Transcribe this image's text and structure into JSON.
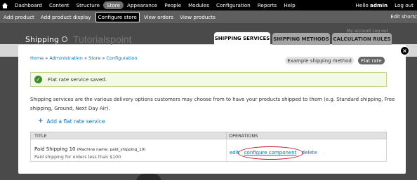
{
  "toolbar": {
    "items": [
      {
        "label": "Dashboard",
        "active": false
      },
      {
        "label": "Content",
        "active": false
      },
      {
        "label": "Structure",
        "active": false
      },
      {
        "label": "Store",
        "active": true
      },
      {
        "label": "Appearance",
        "active": false
      },
      {
        "label": "People",
        "active": false
      },
      {
        "label": "Modules",
        "active": false
      },
      {
        "label": "Configuration",
        "active": false
      },
      {
        "label": "Reports",
        "active": false
      },
      {
        "label": "Help",
        "active": false
      }
    ],
    "greeting": "Hello",
    "username": "admin",
    "logout": "Log out"
  },
  "shortcuts": {
    "items": [
      {
        "label": "Add product",
        "active": false
      },
      {
        "label": "Add product display",
        "active": false
      },
      {
        "label": "Configure store",
        "active": true
      },
      {
        "label": "View orders",
        "active": false
      },
      {
        "label": "View products",
        "active": false
      }
    ],
    "edit": "Edit shortc"
  },
  "page": {
    "title": "Shipping",
    "watermark": "Tutorialspoint",
    "my_account": "My account   Log out"
  },
  "tabs": [
    {
      "label": "SHIPPING SERVICES",
      "active": true
    },
    {
      "label": "SHIPPING METHODS",
      "active": false
    },
    {
      "label": "CALCULATION RULES",
      "active": false
    }
  ],
  "breadcrumb": [
    "Home",
    "Administration",
    "Store",
    "Configuration"
  ],
  "breadcrumb_sep": "»",
  "method_pills": [
    {
      "label": "Example shipping method",
      "active": false
    },
    {
      "label": "Flat rate",
      "active": true
    }
  ],
  "status": {
    "message": "Flat rate service saved."
  },
  "description": "Shipping services are the various delivery options customers may choose from to have your products shipped to them (e.g. Standard shipping, Free shipping, Ground, Next Day Air).",
  "add_link": "Add a flat rate service",
  "table": {
    "headers": [
      "TITLE",
      "OPERATIONS"
    ],
    "rows": [
      {
        "title": "Paid Shipping 10",
        "machine_name": "(Machine name: paid_shipping_10)",
        "description": "Paid shipping for orders less than $100",
        "operations": [
          "edit",
          "configure component",
          "delete"
        ]
      }
    ]
  },
  "colors": {
    "link": "#0074bd",
    "toolbar": "#000000",
    "shortcuts": "#5e5e5e",
    "status_bg": "#f3f9e5",
    "status_ok": "#3c8a2e",
    "highlight": "#c8102e"
  }
}
